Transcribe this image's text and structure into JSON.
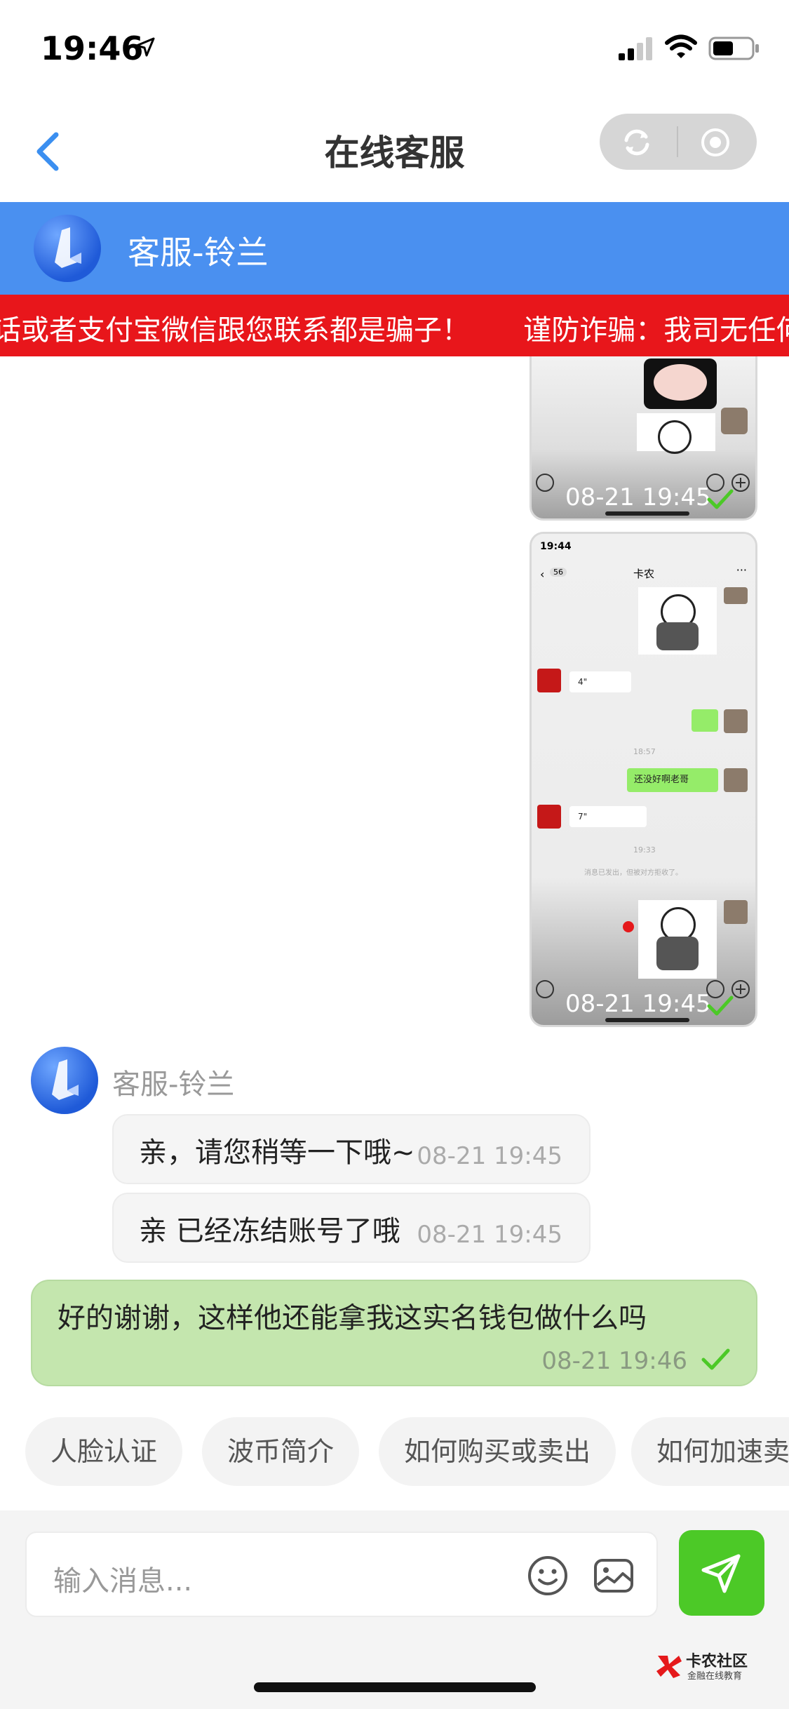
{
  "status_bar": {
    "time": "19:46"
  },
  "nav": {
    "title": "在线客服"
  },
  "agent_header": {
    "name": "客服-铃兰"
  },
  "notice": {
    "text": "话或者支付宝微信跟您联系都是骗子！      谨防诈骗：我司无任何"
  },
  "screenshots": [
    {
      "timestamp": "08-21 19:45"
    },
    {
      "timestamp": "08-21 19:45",
      "inner": {
        "time": "19:44",
        "back_count": "56",
        "title": "卡农",
        "voice1": "4\"",
        "time1": "18:57",
        "reply": "还没好啊老哥",
        "voice2": "7\"",
        "time2": "19:33",
        "notice": "消息已发出，但被对方拒收了。"
      }
    }
  ],
  "conversation": {
    "agent_name": "客服-铃兰",
    "incoming": [
      {
        "text": "亲，请您稍等一下哦~",
        "time": "08-21 19:45"
      },
      {
        "text": "亲 已经冻结账号了哦",
        "time": "08-21 19:45"
      }
    ],
    "outgoing": {
      "text": "好的谢谢，这样他还能拿我这实名钱包做什么吗",
      "time": "08-21 19:46"
    }
  },
  "quick_replies": [
    "人脸认证",
    "波币简介",
    "如何购买或卖出",
    "如何加速卖出"
  ],
  "input": {
    "placeholder": "输入消息..."
  },
  "watermark": {
    "title": "卡农社区",
    "subtitle": "金融在线教育"
  },
  "colors": {
    "accent_blue": "#4a90f0",
    "notice_red": "#e8161b",
    "send_green": "#4cc927",
    "outgoing_bubble": "#c4e6ae"
  }
}
